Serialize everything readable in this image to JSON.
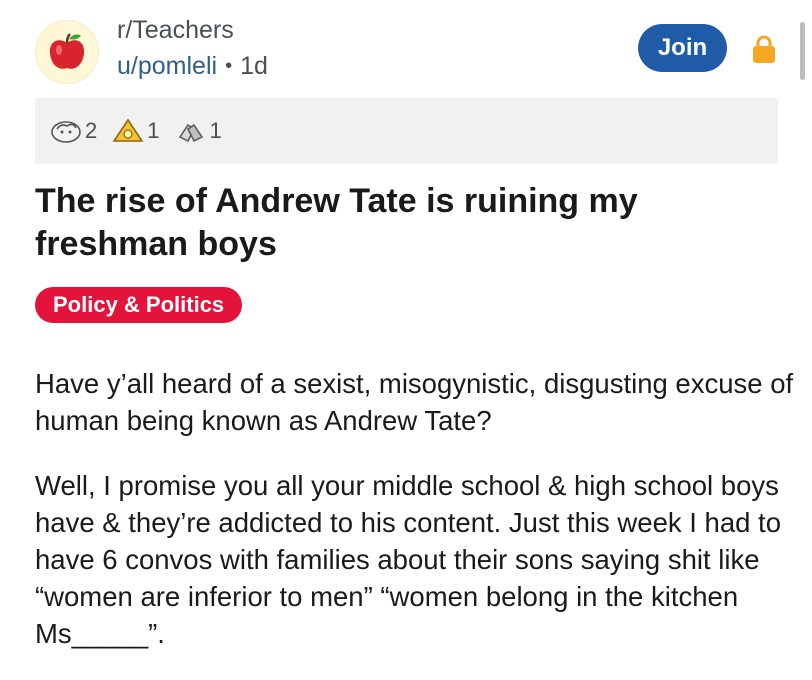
{
  "post": {
    "subreddit": "r/Teachers",
    "author": "u/pomleli",
    "separator": "•",
    "age": "1d",
    "join_label": "Join",
    "awards": [
      {
        "icon": "helpful-award-icon",
        "count": "2"
      },
      {
        "icon": "gold-award-icon",
        "count": "1"
      },
      {
        "icon": "hands-award-icon",
        "count": "1"
      }
    ],
    "title": "The rise of Andrew Tate is ruining my freshman boys",
    "flair": "Policy & Politics",
    "flair_color": "#e4133c",
    "body_paragraphs": [
      "Have y’all heard of a sexist, misogynistic, disgusting excuse of human being known as Andrew Tate?",
      "Well, I promise you all your middle school & high school boys have & they’re addicted to his content. Just this week I had to have 6 convos with families about their sons saying shit like “women are inferior to men” “women belong in the kitchen Ms_____”."
    ],
    "colors": {
      "join": "#1f5ba6",
      "lock": "#f5a623",
      "award_bg": "#f1f1f1"
    }
  }
}
